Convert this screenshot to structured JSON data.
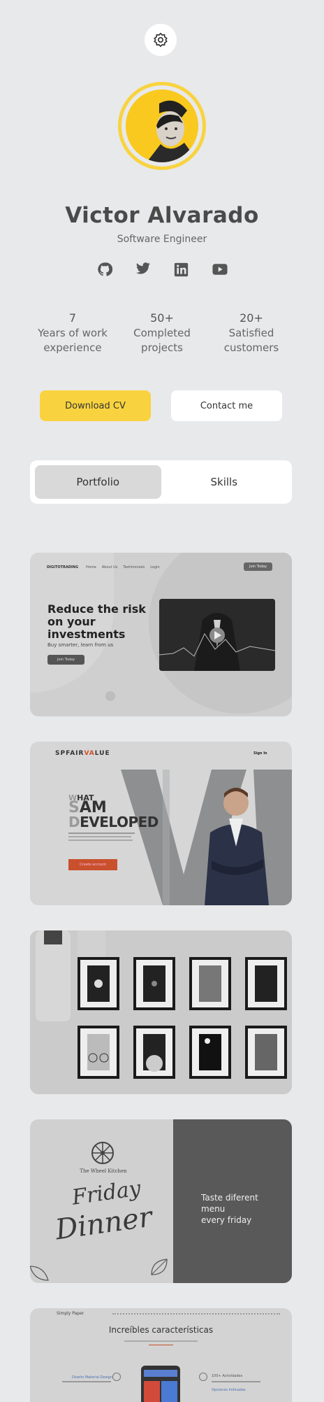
{
  "profile": {
    "name": "Victor Alvarado",
    "role": "Software Engineer"
  },
  "icons": {
    "theme": "gear-icon",
    "socials": [
      "github-icon",
      "twitter-icon",
      "linkedin-icon",
      "youtube-icon"
    ]
  },
  "stats": [
    {
      "num": "7",
      "line1": "Years of work",
      "line2": "experience"
    },
    {
      "num": "50+",
      "line1": "Completed",
      "line2": "projects"
    },
    {
      "num": "20+",
      "line1": "Satisfied",
      "line2": "customers"
    }
  ],
  "actions": {
    "download": "Download CV",
    "contact": "Contact me"
  },
  "tabs": [
    {
      "label": "Portfolio",
      "active": true
    },
    {
      "label": "Skills",
      "active": false
    }
  ],
  "colors": {
    "accent": "#f9d33f",
    "background": "#e8e9eb"
  },
  "portfolio": {
    "p1": {
      "brand": "DIGITOTRADING",
      "nav": [
        "Home",
        "About Us",
        "Testimonials",
        "Login"
      ],
      "cta": "Join Today",
      "headline1": "Reduce the risk",
      "headline2": "on your",
      "headline3": "investments",
      "sub": "Buy smarter, learn from us",
      "button": "Join Today"
    },
    "p2": {
      "brand1": "SPFAIR",
      "brand2": "VA",
      "brand3": "LUE",
      "signin": "Sign In",
      "w1a": "W",
      "w1b": "HAT",
      "w2a": "S",
      "w2b": "AM",
      "w3a": "D",
      "w3b": "EVELOPED",
      "button": "Create account"
    },
    "p4": {
      "brand": "The Wheel Kitchen",
      "script1": "Friday",
      "script2": "Dinner",
      "tag1": "Taste diferent",
      "tag2": "menu",
      "tag3": "every friday"
    },
    "p5": {
      "brand": "Simply Paper",
      "title": "Increíbles características",
      "feature1": "Diseño Material Design",
      "feature2": "100+ Actividades",
      "feature3": "Opciones Indicadas"
    }
  }
}
